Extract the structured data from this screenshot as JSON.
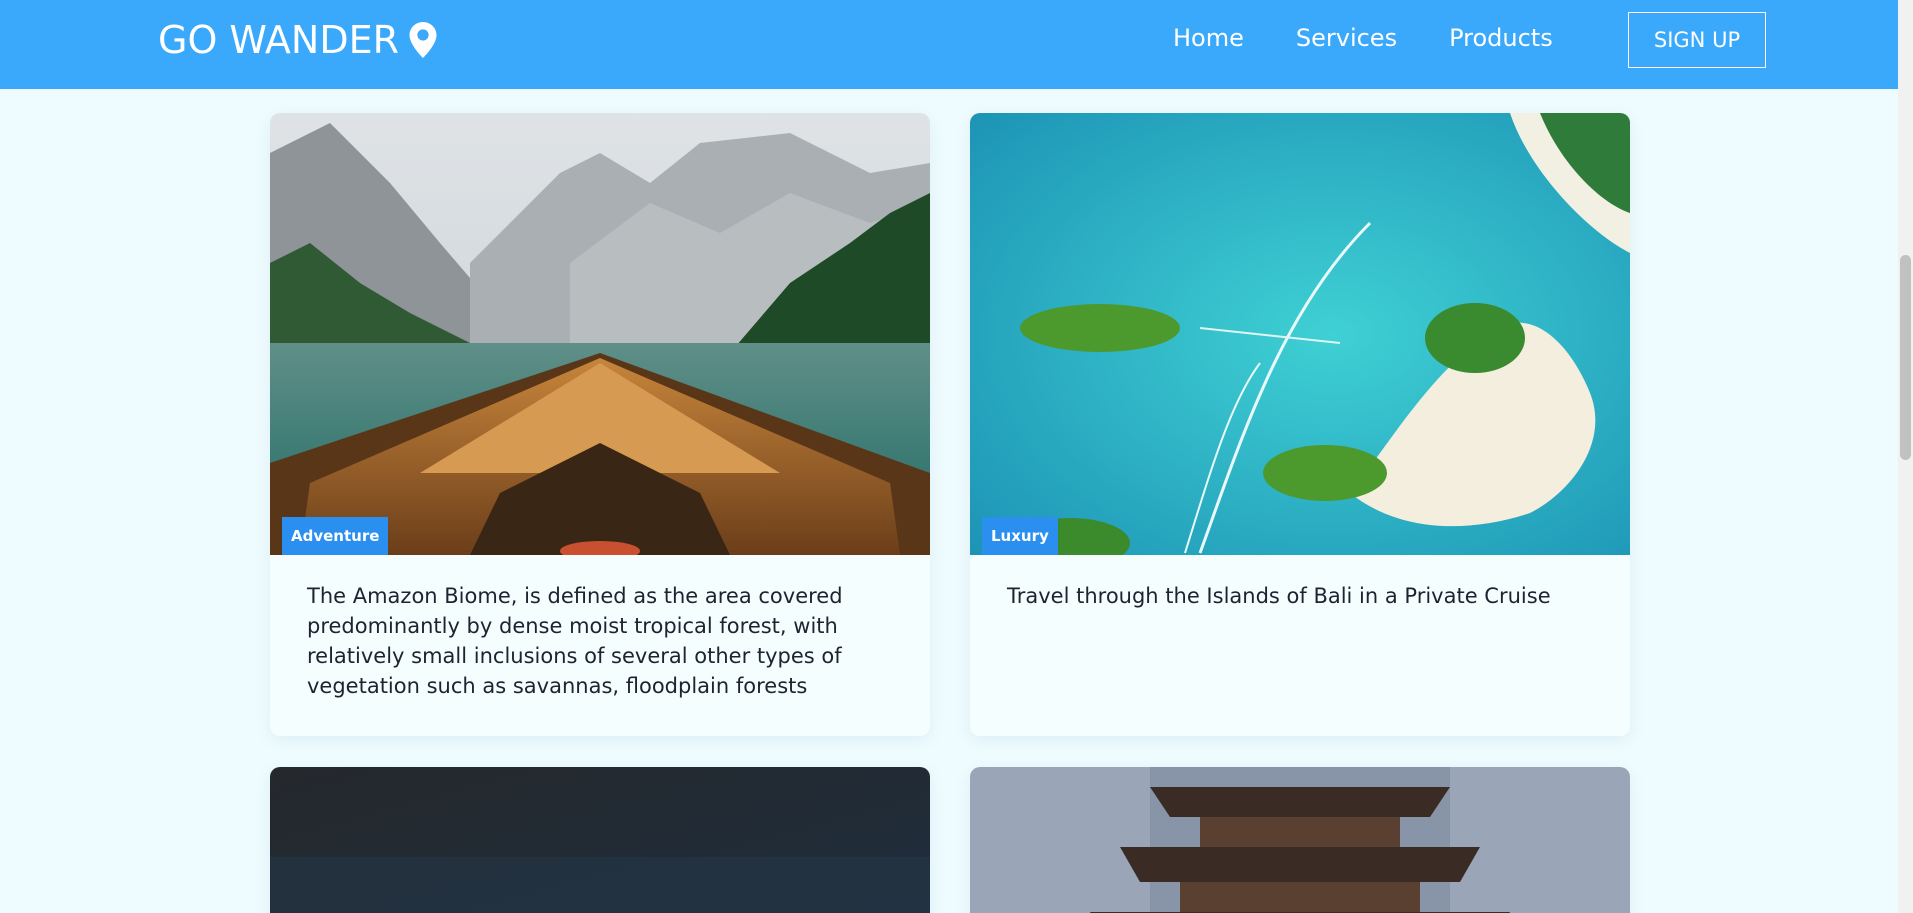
{
  "nav": {
    "brand": "GO WANDER",
    "links": [
      {
        "label": "Home"
      },
      {
        "label": "Services"
      },
      {
        "label": "Products"
      }
    ],
    "signup_label": "SIGN UP"
  },
  "cards": [
    {
      "tag": "Adventure",
      "text": "The Amazon Biome, is defined as the area covered predominantly by dense moist tropical forest, with relatively small inclusions of several other types of vegetation such as savannas, floodplain forests"
    },
    {
      "tag": "Luxury",
      "text": "Travel through the Islands of Bali in a Private Cruise"
    }
  ],
  "colors": {
    "navbar": "#3aa9fb",
    "background": "#effcff",
    "tag": "#2b8ff0",
    "card_text": "#1f2330"
  },
  "icons": {
    "brand": "map-pin-icon"
  }
}
